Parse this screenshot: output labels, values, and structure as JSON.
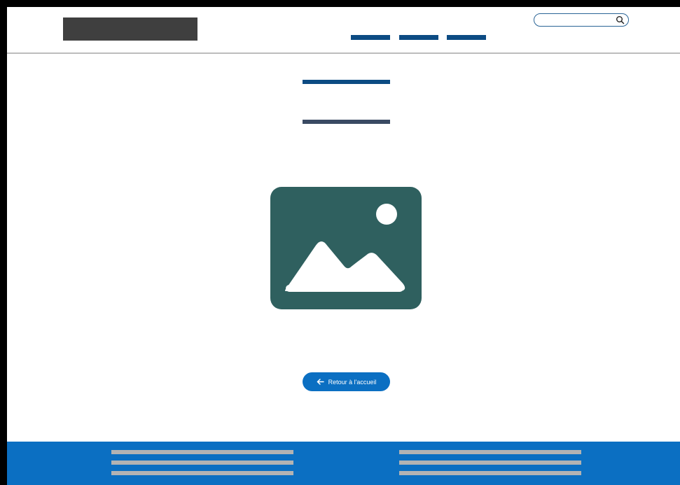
{
  "header": {
    "logo_icon": "logo-placeholder",
    "nav_link_count": 3,
    "search": {
      "placeholder": "",
      "value": "",
      "icon": "search-icon"
    }
  },
  "main": {
    "image_icon": "image-placeholder-icon",
    "back_button": {
      "label": "Retour à l'accueil",
      "icon": "arrow-left-icon"
    }
  },
  "footer": {
    "line_count": 6
  },
  "colors": {
    "frame": "#000000",
    "logo": "#3f3f3f",
    "nav_accent": "#0c4b83",
    "title_primary": "#0c4b83",
    "title_secondary": "#3a4a63",
    "image_placeholder": "#2f605f",
    "primary_button": "#0b6fc2",
    "footer": "#0b6fc2",
    "footer_lines": "#b3b3b3"
  }
}
